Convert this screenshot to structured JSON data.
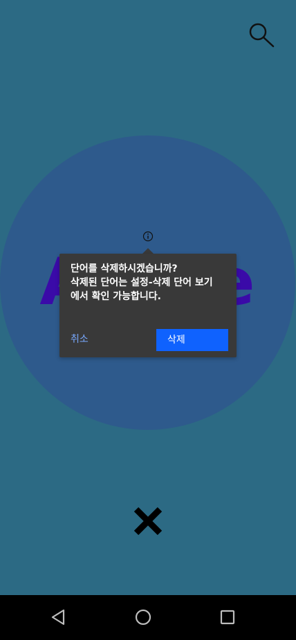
{
  "app": {
    "background_color": "#2c6a84",
    "accent_color": "#0f62fe"
  },
  "toolbar": {
    "search_icon": "search-icon"
  },
  "flashcard": {
    "word": "Apple",
    "circle_color": "#2e5a8c",
    "word_color": "#3a0aa8"
  },
  "dialog": {
    "info_icon": "info-icon",
    "line1": "단어를 삭제하시겠습니까?",
    "line2": "삭제된 단어는 설정-삭제 단어 보기",
    "line3": "에서 확인 가능합니다.",
    "cancel_label": "취소",
    "delete_label": "삭제"
  },
  "close_icon": "close-icon",
  "navbar": {
    "back_icon": "back-triangle-icon",
    "home_icon": "home-circle-icon",
    "recent_icon": "recent-apps-square-icon"
  }
}
